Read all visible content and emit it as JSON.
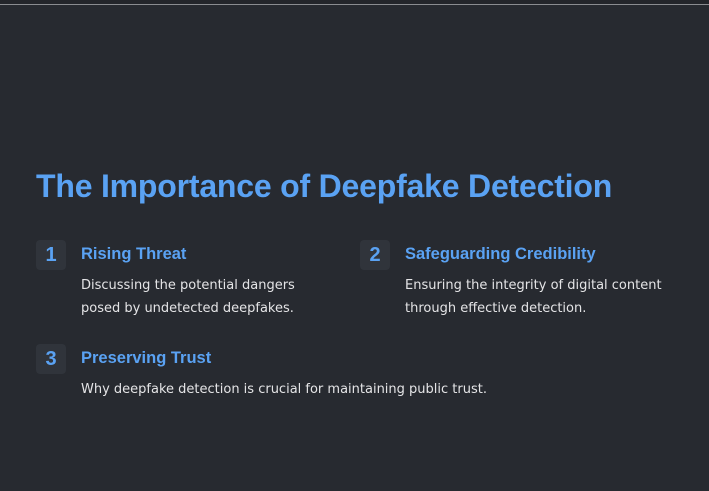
{
  "slide": {
    "title": "The Importance of Deepfake Detection",
    "items": [
      {
        "number": "1",
        "title": "Rising Threat",
        "description": "Discussing the potential dangers posed by undetected deepfakes."
      },
      {
        "number": "2",
        "title": "Safeguarding Credibility",
        "description": "Ensuring the integrity of digital content through effective detection."
      },
      {
        "number": "3",
        "title": "Preserving Trust",
        "description": "Why deepfake detection is crucial for maintaining public trust."
      }
    ]
  },
  "colors": {
    "background": "#272a30",
    "accent": "#5aa2f3",
    "body_text": "#e4e4e6",
    "badge_bg": "#30343b"
  }
}
